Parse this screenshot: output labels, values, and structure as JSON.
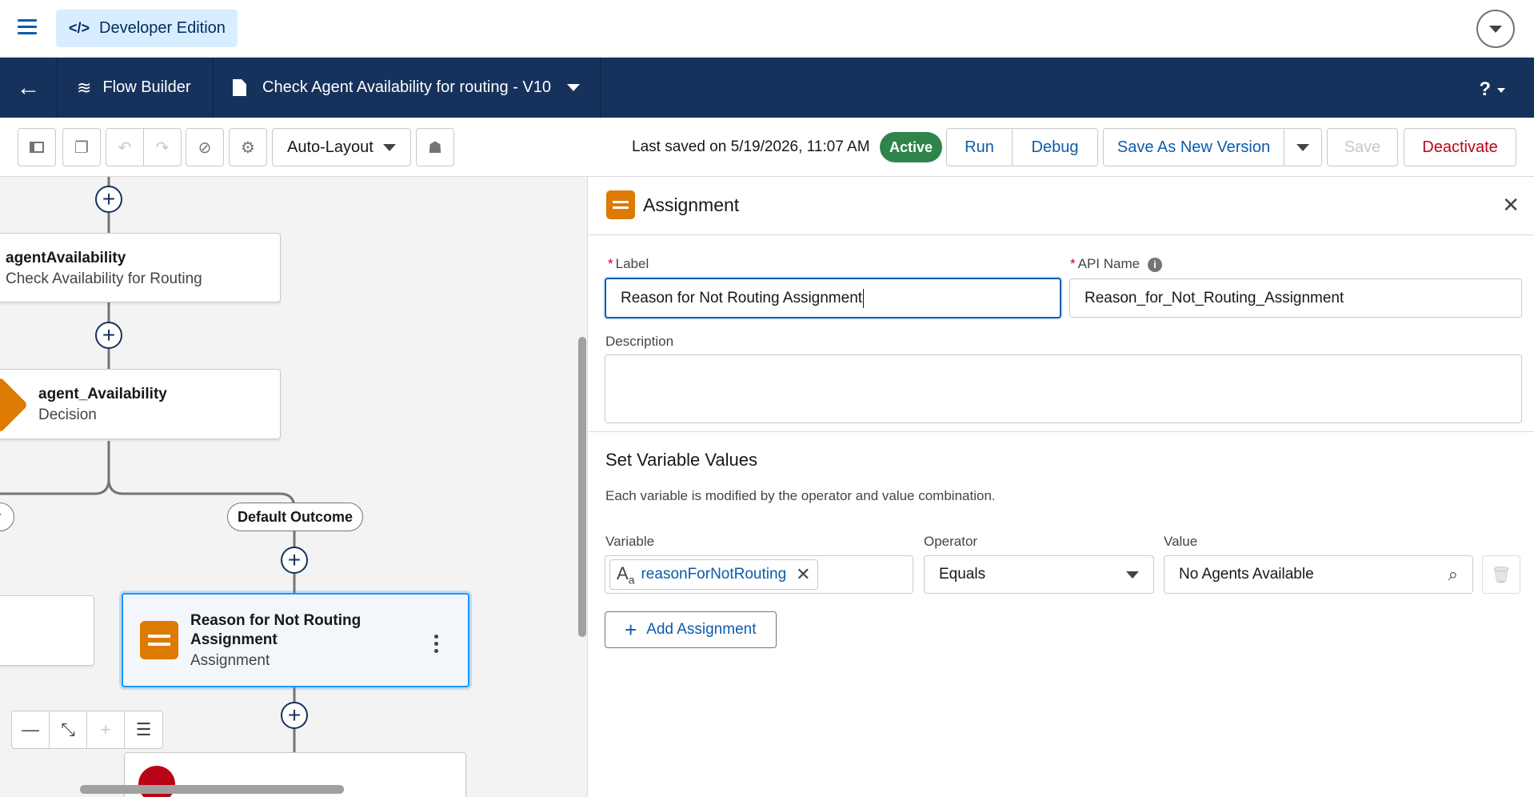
{
  "appbar": {
    "edition_label": "Developer Edition",
    "edition_code_glyph": "</>"
  },
  "header": {
    "back_glyph": "←",
    "builder_label": "Flow Builder",
    "flow_title": "Check Agent Availability for routing - V10",
    "help_glyph": "?"
  },
  "toolbar": {
    "layout_mode": "Auto-Layout",
    "last_saved": "Last saved on 5/19/2026, 11:07 AM",
    "status_badge": "Active",
    "run_label": "Run",
    "debug_label": "Debug",
    "save_new_version_label": "Save As New Version",
    "save_label": "Save",
    "deactivate_label": "Deactivate"
  },
  "canvas": {
    "nodes": [
      {
        "title": "agentAvailability",
        "subtitle": "Check Availability for Routing"
      },
      {
        "title": "agent_Availability",
        "subtitle": "Decision"
      },
      {
        "title_line1": "Reason for Not Routing",
        "title_line2": "Assignment",
        "subtitle": "Assignment"
      }
    ],
    "branch_label": "Default Outcome",
    "left_branch_fragment": "y"
  },
  "panel": {
    "title": "Assignment",
    "label_field": {
      "label": "Label",
      "value": "Reason for Not Routing Assignment"
    },
    "api_name_field": {
      "label": "API Name",
      "value": "Reason_for_Not_Routing_Assignment"
    },
    "description": {
      "label": "Description",
      "value": ""
    },
    "section_title": "Set Variable Values",
    "section_help": "Each variable is modified by the operator and value combination.",
    "row": {
      "variable_label": "Variable",
      "variable_value": "reasonForNotRouting",
      "operator_label": "Operator",
      "operator_value": "Equals",
      "value_label": "Value",
      "value_value": "No Agents Available"
    },
    "add_assignment_label": "Add Assignment"
  },
  "colors": {
    "header_bg": "#16325c",
    "brand_blue": "#0b5cab",
    "active_green": "#2e844a",
    "assignment_orange": "#dd7a01",
    "danger_red": "#ba0517"
  }
}
